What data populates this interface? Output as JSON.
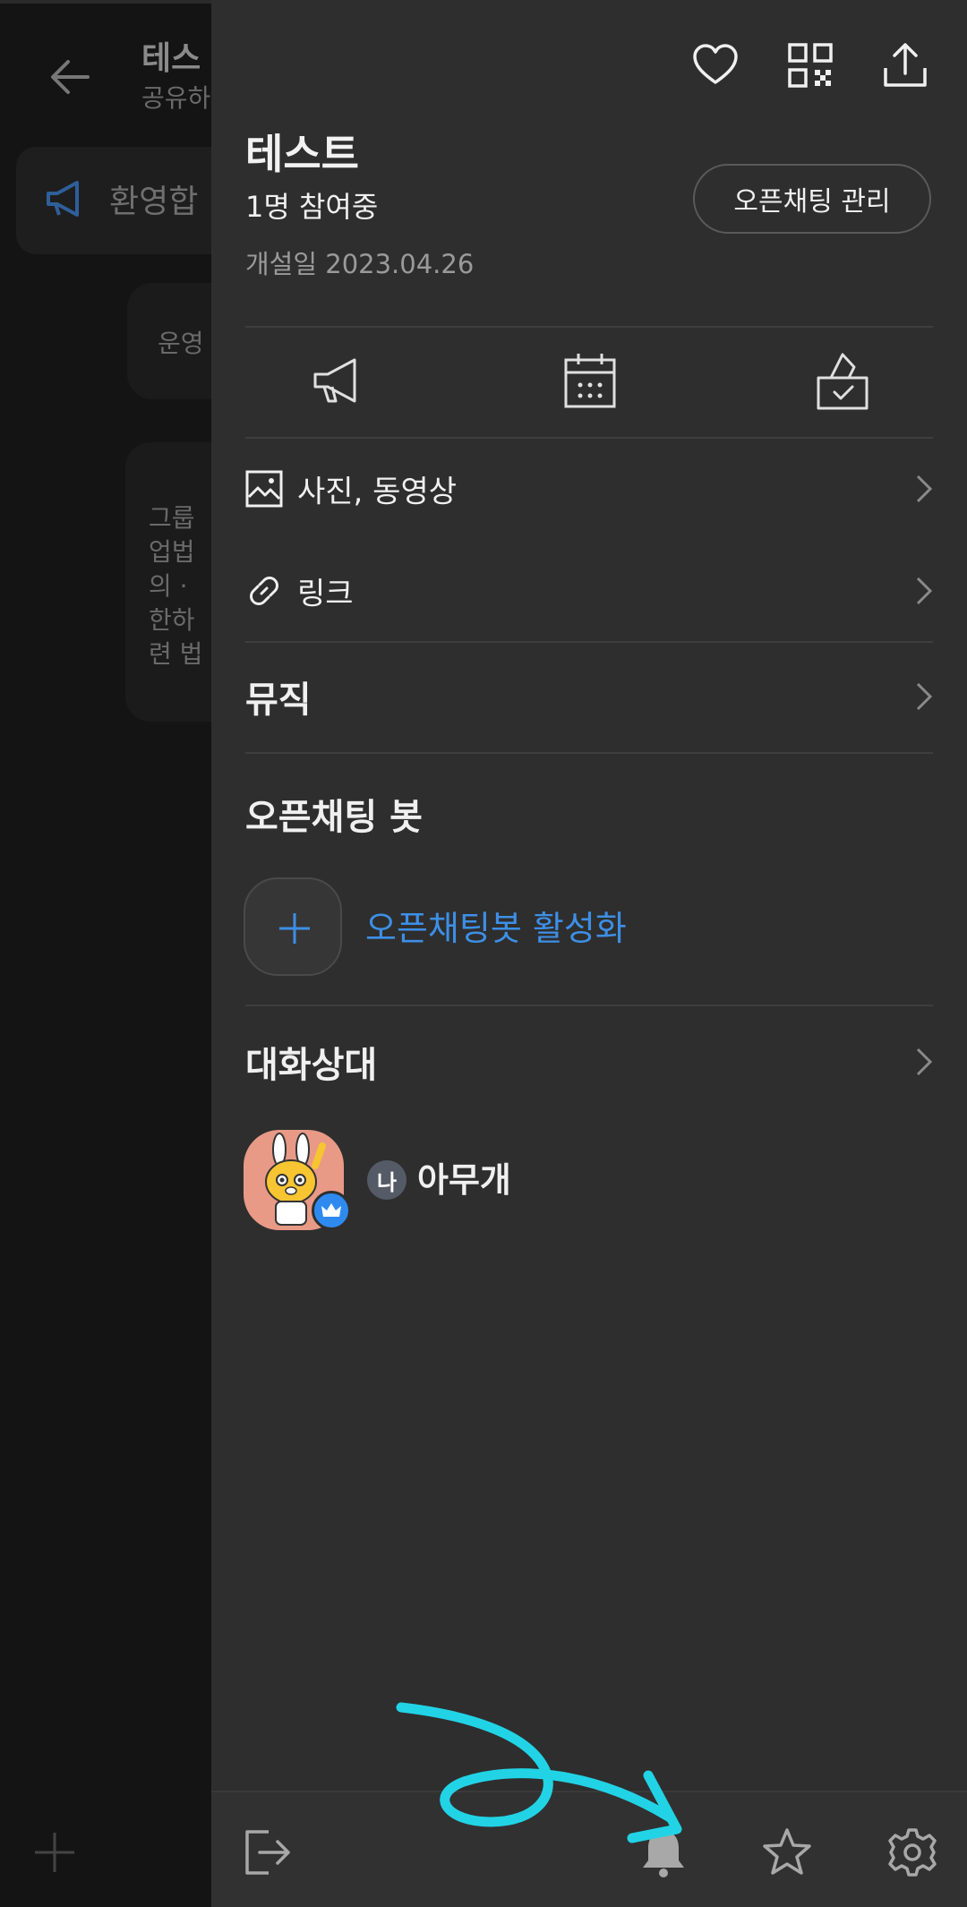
{
  "background_chat": {
    "title": "테스",
    "subtitle": "공유하",
    "notice_text": "환영합",
    "bubble1_text": "운영",
    "bubble2_lines": "그룹\n업법\n의 ·\n한하\n련 법"
  },
  "drawer": {
    "top_actions": [
      "heart-icon",
      "qr-code-icon",
      "share-icon"
    ],
    "room_title": "테스트",
    "participants": "1명 참여중",
    "created_date": "개설일 2023.04.26",
    "manage_button": "오픈채팅 관리",
    "quick_actions": [
      "notice-icon",
      "calendar-icon",
      "vote-icon"
    ],
    "menu": {
      "photos": "사진, 동영상",
      "links": "링크",
      "music": "뮤직"
    },
    "bot_section": {
      "title": "오픈채팅 봇",
      "activate_label": "오픈채팅봇 활성화"
    },
    "members_section": {
      "title": "대화상대",
      "members": [
        {
          "me_badge": "나",
          "name": "아무개",
          "role": "host"
        }
      ]
    },
    "bottom_bar": [
      "exit-icon",
      "bell-icon",
      "star-icon",
      "settings-icon"
    ]
  },
  "colors": {
    "drawer_bg": "#2e2e2e",
    "accent_blue": "#3d8fe6",
    "annotation_cyan": "#22d3e6"
  }
}
